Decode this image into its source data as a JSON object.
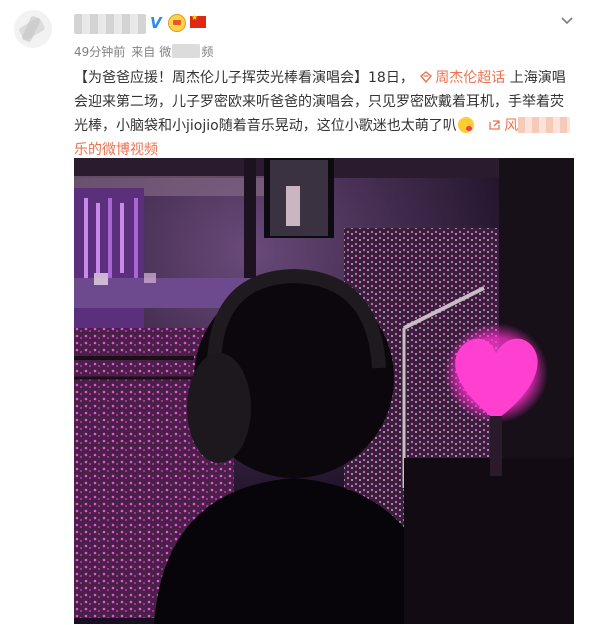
{
  "header": {
    "timestamp": "49分钟前",
    "source_prefix": "来自",
    "source_suffix": "微",
    "source_end": "频"
  },
  "post": {
    "title": "【为爸爸应援！周杰伦儿子挥荧光棒看演唱会】",
    "text_1": "18日，",
    "topic_link": "周杰伦超话",
    "text_2": "上海演唱会迎来第二场，儿子罗密欧来听爸爸的演唱会，只见罗密欧戴着耳机，手举着荧光棒，小脑袋和小jiojio随着音乐晃动，这位小歌迷也太萌了叭",
    "video_link_prefix": "风",
    "video_link_suffix": "乐的微博视频"
  },
  "icons": {
    "verified": "verified-v-icon",
    "member": "crown-member-icon",
    "flag": "china-flag-icon",
    "menu": "chevron-down-icon",
    "topic": "supertopic-diamond-icon",
    "video": "video-link-icon",
    "emoji": "cute-emoji-icon"
  },
  "colors": {
    "link": "#eb7350",
    "verified": "#2a8ce6",
    "meta": "#808080",
    "glowstick": "#ff3fd0"
  }
}
